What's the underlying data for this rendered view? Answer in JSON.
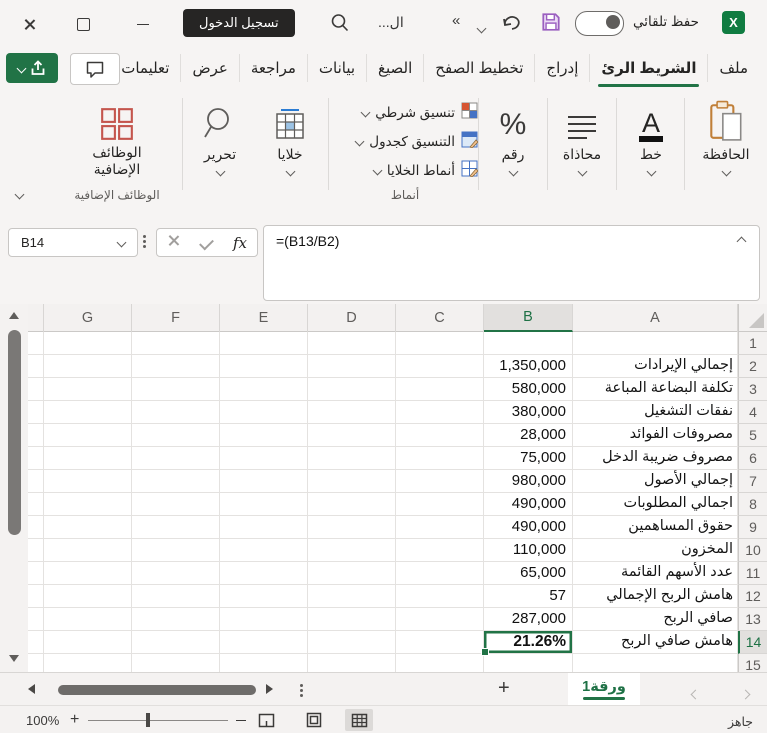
{
  "colors": {
    "excel_green": "#107c41",
    "accent_green": "#217346",
    "save_purple": "#9b5fc0",
    "signin_bg": "#262524"
  },
  "title_bar": {
    "autosave_label": "حفظ تلقائي",
    "doc_title": "ال...",
    "more_glyph": "«",
    "sign_in_label": "تسجيل الدخول"
  },
  "ribbon_tabs": {
    "items": [
      {
        "label": "ملف",
        "active": false
      },
      {
        "label": "الشريط الرئ",
        "active": true
      },
      {
        "label": "إدراج",
        "active": false
      },
      {
        "label": "تخطيط الصفح",
        "active": false
      },
      {
        "label": "الصيغ",
        "active": false
      },
      {
        "label": "بيانات",
        "active": false
      },
      {
        "label": "مراجعة",
        "active": false
      },
      {
        "label": "عرض",
        "active": false
      },
      {
        "label": "تعليمات",
        "active": false
      }
    ]
  },
  "ribbon": {
    "clipboard_label": "الحافظة",
    "font_label": "خط",
    "alignment_label": "محاذاة",
    "number_label": "رقم",
    "styles": {
      "items": [
        "تنسيق شرطي",
        "التنسيق كجدول",
        "أنماط الخلايا"
      ],
      "group_label": "أنماط"
    },
    "cells_label": "خلايا",
    "editing_label": "تحرير",
    "addins_label_line1": "الوظائف",
    "addins_label_line2": "الإضافية",
    "addins_group_label": "الوظائف الإضافية"
  },
  "formula_bar": {
    "name_box": "B14",
    "formula": "=(B13/B2)",
    "fx": "fx"
  },
  "grid": {
    "columns": [
      "G",
      "F",
      "E",
      "D",
      "C",
      "B",
      "A"
    ],
    "selected_column": "B",
    "selected_row": 14,
    "selected_cell": "B14",
    "rows": [
      {
        "n": "1",
        "a": "",
        "b": ""
      },
      {
        "n": "2",
        "a": "إجمالي الإيرادات",
        "b": "1,350,000"
      },
      {
        "n": "3",
        "a": "تكلفة البضاعة المباعة",
        "b": "580,000"
      },
      {
        "n": "4",
        "a": "نفقات التشغيل",
        "b": "380,000"
      },
      {
        "n": "5",
        "a": "مصروفات الفوائد",
        "b": "28,000"
      },
      {
        "n": "6",
        "a": "مصروف ضريبة الدخل",
        "b": "75,000"
      },
      {
        "n": "7",
        "a": "إجمالي الأصول",
        "b": "980,000"
      },
      {
        "n": "8",
        "a": "اجمالي المطلوبات",
        "b": "490,000"
      },
      {
        "n": "9",
        "a": "حقوق المساهمين",
        "b": "490,000"
      },
      {
        "n": "10",
        "a": "المخزون",
        "b": "110,000"
      },
      {
        "n": "11",
        "a": "عدد الأسهم القائمة",
        "b": "65,000"
      },
      {
        "n": "12",
        "a": "هامش الربح الإجمالي",
        "b": "57"
      },
      {
        "n": "13",
        "a": "صافي الربح",
        "b": "287,000"
      },
      {
        "n": "14",
        "a": "هامش صافي الربح",
        "b": "21.26%"
      },
      {
        "n": "15",
        "a": "",
        "b": ""
      }
    ]
  },
  "sheet_bar": {
    "sheet_tab": "ورقة1",
    "add_label": "+"
  },
  "status_bar": {
    "ready_label": "جاهز",
    "zoom_level": "100%"
  }
}
